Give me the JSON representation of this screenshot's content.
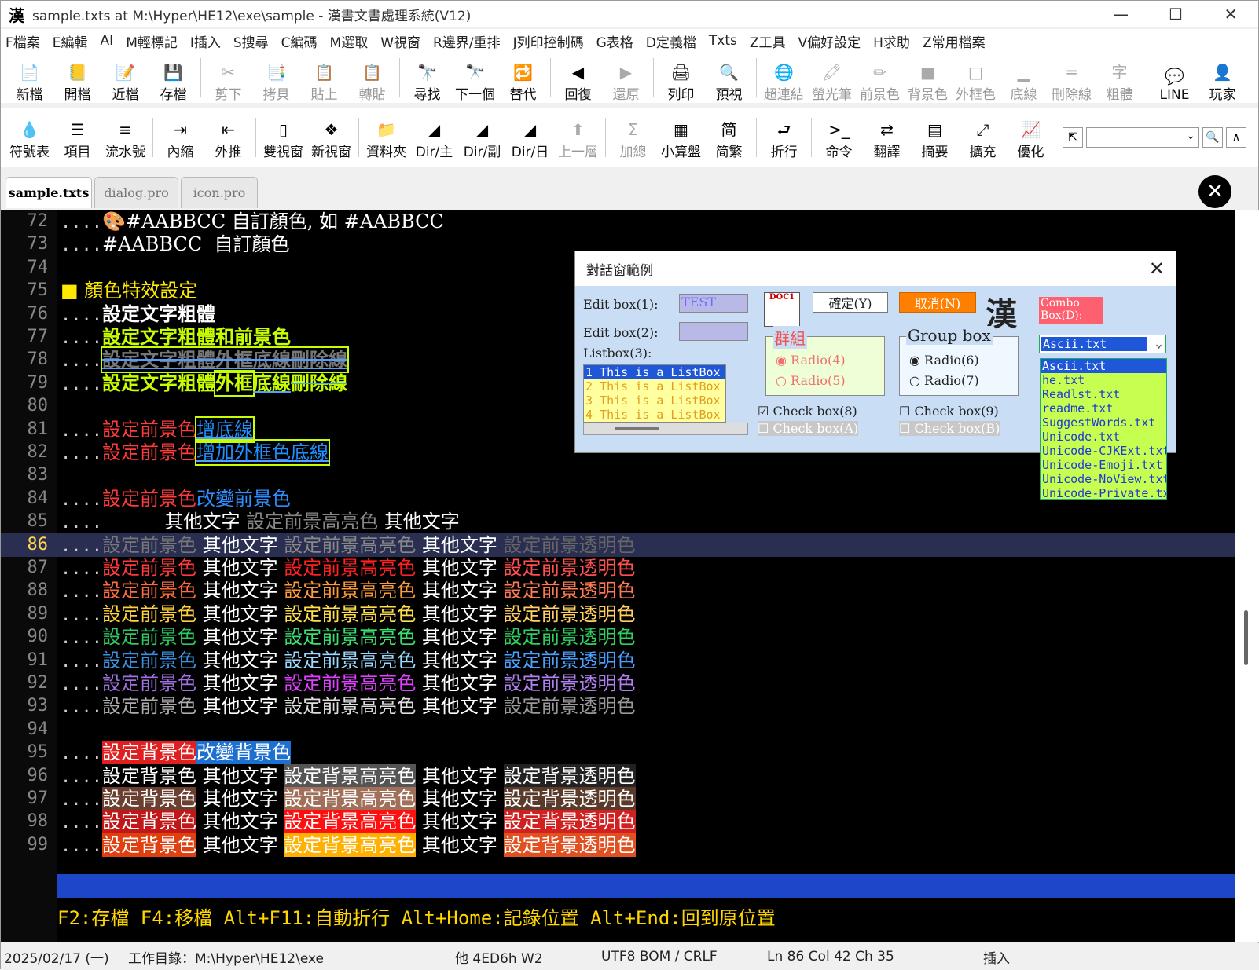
{
  "window": {
    "app_icon": "漢",
    "title": "sample.txts at M:\\Hyper\\HE12\\exe\\sample - 漢書文書處理系統(V12)",
    "min": "—",
    "max": "☐",
    "close": "✕"
  },
  "menu": [
    "F檔案",
    "E編輯",
    "AI",
    "M輕標記",
    "I插入",
    "S搜尋",
    "C編碼",
    "M選取",
    "W視窗",
    "R邊界/重排",
    "J列印控制碼",
    "G表格",
    "D定義檔",
    "Txts",
    "Z工具",
    "V偏好設定",
    "H求助",
    "Z常用檔案"
  ],
  "toolbar1": [
    {
      "icon": "📄",
      "label": "新檔",
      "enabled": true
    },
    {
      "icon": "📒",
      "label": "開檔",
      "enabled": true
    },
    {
      "icon": "📝",
      "label": "近檔",
      "enabled": true
    },
    {
      "icon": "💾",
      "label": "存檔",
      "enabled": true
    },
    {
      "icon": "✂",
      "label": "剪下",
      "enabled": false
    },
    {
      "icon": "📑",
      "label": "拷貝",
      "enabled": false
    },
    {
      "icon": "📋",
      "label": "貼上",
      "enabled": false
    },
    {
      "icon": "📋",
      "label": "轉貼",
      "enabled": false
    },
    {
      "icon": "🔭",
      "label": "尋找",
      "enabled": true
    },
    {
      "icon": "🔭",
      "label": "下一個",
      "enabled": true
    },
    {
      "icon": "🔁",
      "label": "替代",
      "enabled": true
    },
    {
      "icon": "◀",
      "label": "回復",
      "enabled": true
    },
    {
      "icon": "▶",
      "label": "還原",
      "enabled": false
    },
    {
      "icon": "🖨",
      "label": "列印",
      "enabled": true
    },
    {
      "icon": "🔍",
      "label": "預視",
      "enabled": true
    },
    {
      "icon": "🌐",
      "label": "超連結",
      "enabled": false
    },
    {
      "icon": "🖍",
      "label": "螢光筆",
      "enabled": false
    },
    {
      "icon": "✏",
      "label": "前景色",
      "enabled": false
    },
    {
      "icon": "■",
      "label": "背景色",
      "enabled": false
    },
    {
      "icon": "□",
      "label": "外框色",
      "enabled": false
    },
    {
      "icon": "▁",
      "label": "底線",
      "enabled": false
    },
    {
      "icon": "═",
      "label": "刪除線",
      "enabled": false
    },
    {
      "icon": "字",
      "label": "粗體",
      "enabled": false
    },
    {
      "icon": "💬",
      "label": "LINE",
      "enabled": true
    },
    {
      "icon": "👤",
      "label": "玩家",
      "enabled": true
    }
  ],
  "toolbar2": [
    {
      "icon": "💧",
      "label": "符號表"
    },
    {
      "icon": "☰",
      "label": "項目"
    },
    {
      "icon": "≡",
      "label": "流水號"
    },
    {
      "icon": "⇥",
      "label": "內縮"
    },
    {
      "icon": "⇤",
      "label": "外推"
    },
    {
      "icon": "▯",
      "label": "雙視窗"
    },
    {
      "icon": "❖",
      "label": "新視窗"
    },
    {
      "icon": "📁",
      "label": "資料夾"
    },
    {
      "icon": "◢",
      "label": "Dir/主"
    },
    {
      "icon": "◢",
      "label": "Dir/副"
    },
    {
      "icon": "◢",
      "label": "Dir/日"
    },
    {
      "icon": "⬆",
      "label": "上一層"
    },
    {
      "icon": "Σ",
      "label": "加總"
    },
    {
      "icon": "▦",
      "label": "小算盤"
    },
    {
      "icon": "简",
      "label": "简繁"
    },
    {
      "icon": "⮐",
      "label": "折行"
    },
    {
      "icon": ">_",
      "label": "命令"
    },
    {
      "icon": "⇄",
      "label": "翻譯"
    },
    {
      "icon": "▤",
      "label": "摘要"
    },
    {
      "icon": "⤢",
      "label": "擴充"
    },
    {
      "icon": "📈",
      "label": "優化"
    }
  ],
  "search_bar": {
    "back": "⇱",
    "search": "🔍",
    "up": "∧"
  },
  "tabs": [
    "sample.txts",
    "dialog.pro",
    "icon.pro"
  ],
  "close_badge": "✕",
  "lines": [
    {
      "n": "72",
      "segs": [
        {
          "t": "....",
          "c": "#ccc",
          "d": 1
        },
        {
          "t": "🎨#AABBCC 自訂顏色, 如 #AABBCC",
          "c": "#fff"
        }
      ]
    },
    {
      "n": "73",
      "segs": [
        {
          "t": "....",
          "c": "#ccc",
          "d": 1
        },
        {
          "t": "#AABBCC  自訂顏色",
          "c": "#fff"
        }
      ]
    },
    {
      "n": "74",
      "segs": []
    },
    {
      "n": "75",
      "segs": [
        {
          "t": "■ 顏色特效設定",
          "c": "#ffe800"
        }
      ]
    },
    {
      "n": "76",
      "segs": [
        {
          "t": "....",
          "c": "#ccc",
          "d": 1
        },
        {
          "t": "設定文字粗體",
          "c": "#fff",
          "w": "bold"
        }
      ]
    },
    {
      "n": "77",
      "segs": [
        {
          "t": "....",
          "c": "#ccc",
          "d": 1
        },
        {
          "t": "設定文字粗體和前景色",
          "c": "#c8ff00",
          "w": "bold"
        }
      ]
    },
    {
      "n": "78",
      "segs": [
        {
          "t": "....",
          "c": "#ccc",
          "d": 1
        },
        {
          "t": "設定文字粗體外框底線刪除線",
          "c": "#777",
          "w": "bold",
          "b": "#c8ff00",
          "dec": "line-through underline"
        }
      ]
    },
    {
      "n": "79",
      "segs": [
        {
          "t": "....",
          "c": "#ccc",
          "d": 1
        },
        {
          "t": "設定文字粗體",
          "c": "#c8ff00",
          "w": "bold"
        },
        {
          "t": "外框",
          "c": "#c8ff00",
          "w": "bold",
          "b": "#c8ff00"
        },
        {
          "t": "底線",
          "c": "#c8ff00",
          "w": "bold",
          "dec": "underline"
        },
        {
          "t": "刪除線",
          "c": "#c8ff00",
          "w": "bold",
          "dec": "line-through"
        }
      ]
    },
    {
      "n": "80",
      "segs": []
    },
    {
      "n": "81",
      "segs": [
        {
          "t": "....",
          "c": "#ccc",
          "d": 1
        },
        {
          "t": "設定前景色",
          "c": "#ff3a3a"
        },
        {
          "t": "增底線",
          "c": "#1e90ff",
          "b": "#c8ff00",
          "dec": "underline"
        }
      ]
    },
    {
      "n": "82",
      "segs": [
        {
          "t": "....",
          "c": "#ccc",
          "d": 1
        },
        {
          "t": "設定前景色",
          "c": "#ff3a3a"
        },
        {
          "t": "增加外框色底線",
          "c": "#1e90ff",
          "b": "#c8ff00",
          "dec": "underline"
        }
      ]
    },
    {
      "n": "83",
      "segs": []
    },
    {
      "n": "84",
      "segs": [
        {
          "t": "....",
          "c": "#ccc",
          "d": 1
        },
        {
          "t": "設定前景色",
          "c": "#ff3a3a"
        },
        {
          "t": "改變前景色",
          "c": "#2e8dff"
        }
      ]
    },
    {
      "n": "85",
      "segs": [
        {
          "t": "....      ",
          "c": "#ccc",
          "d": 1
        },
        {
          "t": "其他文字 ",
          "c": "#fff"
        },
        {
          "t": "設定前景高亮色 ",
          "c": "#888"
        },
        {
          "t": "其他文字",
          "c": "#fff"
        }
      ]
    },
    {
      "n": "86",
      "cur": 1,
      "segs": [
        {
          "t": "....",
          "c": "#ccc",
          "d": 1
        },
        {
          "t": "設定前景色 ",
          "c": "#777"
        },
        {
          "t": "其他文字 ",
          "c": "#fff"
        },
        {
          "t": "設定前景高亮色 ",
          "c": "#888"
        },
        {
          "t": "其他文字 ",
          "c": "#fff"
        },
        {
          "t": "設定前景透明色",
          "c": "#666"
        }
      ]
    },
    {
      "n": "87",
      "segs": [
        {
          "t": "....",
          "c": "#ccc",
          "d": 1
        },
        {
          "t": "設定前景色 ",
          "c": "#ff3a3a"
        },
        {
          "t": "其他文字 ",
          "c": "#fff"
        },
        {
          "t": "設定前景高亮色 ",
          "c": "#ff2020"
        },
        {
          "t": "其他文字 ",
          "c": "#fff"
        },
        {
          "t": "設定前景透明色",
          "c": "#ff5050"
        }
      ]
    },
    {
      "n": "88",
      "segs": [
        {
          "t": "....",
          "c": "#ccc",
          "d": 1
        },
        {
          "t": "設定前景色 ",
          "c": "#ff6a3a"
        },
        {
          "t": "其他文字 ",
          "c": "#fff"
        },
        {
          "t": "設定前景高亮色 ",
          "c": "#ff9a3a"
        },
        {
          "t": "其他文字 ",
          "c": "#fff"
        },
        {
          "t": "設定前景透明色",
          "c": "#ff7a50"
        }
      ]
    },
    {
      "n": "89",
      "segs": [
        {
          "t": "....",
          "c": "#ccc",
          "d": 1
        },
        {
          "t": "設定前景色 ",
          "c": "#ffd23a"
        },
        {
          "t": "其他文字 ",
          "c": "#fff"
        },
        {
          "t": "設定前景高亮色 ",
          "c": "#ffe04a"
        },
        {
          "t": "其他文字 ",
          "c": "#fff"
        },
        {
          "t": "設定前景透明色",
          "c": "#ffd060"
        }
      ]
    },
    {
      "n": "90",
      "segs": [
        {
          "t": "....",
          "c": "#ccc",
          "d": 1
        },
        {
          "t": "設定前景色 ",
          "c": "#2ec860"
        },
        {
          "t": "其他文字 ",
          "c": "#fff"
        },
        {
          "t": "設定前景高亮色 ",
          "c": "#3ae070"
        },
        {
          "t": "其他文字 ",
          "c": "#fff"
        },
        {
          "t": "設定前景透明色",
          "c": "#30d060"
        }
      ]
    },
    {
      "n": "91",
      "segs": [
        {
          "t": "....",
          "c": "#ccc",
          "d": 1
        },
        {
          "t": "設定前景色 ",
          "c": "#3a90e0"
        },
        {
          "t": "其他文字 ",
          "c": "#fff"
        },
        {
          "t": "設定前景高亮色 ",
          "c": "#9ad8ff"
        },
        {
          "t": "其他文字 ",
          "c": "#fff"
        },
        {
          "t": "設定前景透明色",
          "c": "#4aa0ff"
        }
      ]
    },
    {
      "n": "92",
      "segs": [
        {
          "t": "....",
          "c": "#ccc",
          "d": 1
        },
        {
          "t": "設定前景色 ",
          "c": "#a070e0"
        },
        {
          "t": "其他文字 ",
          "c": "#fff"
        },
        {
          "t": "設定前景高亮色 ",
          "c": "#e040ff"
        },
        {
          "t": "其他文字 ",
          "c": "#fff"
        },
        {
          "t": "設定前景透明色",
          "c": "#b080f0"
        }
      ]
    },
    {
      "n": "93",
      "segs": [
        {
          "t": "....",
          "c": "#ccc",
          "d": 1
        },
        {
          "t": "設定前景色 ",
          "c": "#aaa"
        },
        {
          "t": "其他文字 ",
          "c": "#fff"
        },
        {
          "t": "設定前景高亮色 ",
          "c": "#ddd"
        },
        {
          "t": "其他文字 ",
          "c": "#fff"
        },
        {
          "t": "設定前景透明色",
          "c": "#999"
        }
      ]
    },
    {
      "n": "94",
      "segs": []
    },
    {
      "n": "95",
      "segs": [
        {
          "t": "....",
          "c": "#ccc",
          "d": 1
        },
        {
          "t": "設定背景色",
          "c": "#fff",
          "bg": "#e02020"
        },
        {
          "t": "改變背景色",
          "c": "#fff",
          "bg": "#1e70d0"
        }
      ]
    },
    {
      "n": "96",
      "segs": [
        {
          "t": "....",
          "c": "#ccc",
          "d": 1
        },
        {
          "t": "設定背景色 ",
          "c": "#fff"
        },
        {
          "t": "其他文字 ",
          "c": "#fff"
        },
        {
          "t": "設定背景高亮色",
          "c": "#fff",
          "bg": "#555"
        },
        {
          "t": " 其他文字 ",
          "c": "#fff"
        },
        {
          "t": "設定背景透明色",
          "c": "#fff",
          "bg": "#222"
        }
      ]
    },
    {
      "n": "97",
      "segs": [
        {
          "t": "....",
          "c": "#ccc",
          "d": 1
        },
        {
          "t": "設定背景色",
          "c": "#fff",
          "bg": "#6b4030"
        },
        {
          "t": " 其他文字 ",
          "c": "#fff"
        },
        {
          "t": "設定背景高亮色",
          "c": "#fff",
          "bg": "#a0705a"
        },
        {
          "t": " 其他文字 ",
          "c": "#fff"
        },
        {
          "t": "設定背景透明色",
          "c": "#fff",
          "bg": "#5a3a2a"
        }
      ]
    },
    {
      "n": "98",
      "segs": [
        {
          "t": "....",
          "c": "#ccc",
          "d": 1
        },
        {
          "t": "設定背景色",
          "c": "#fff",
          "bg": "#c01818"
        },
        {
          "t": " 其他文字 ",
          "c": "#fff"
        },
        {
          "t": "設定背景高亮色",
          "c": "#fff",
          "bg": "#ff1010"
        },
        {
          "t": " 其他文字 ",
          "c": "#fff"
        },
        {
          "t": "設定背景透明色",
          "c": "#fff",
          "bg": "#d02020"
        }
      ]
    },
    {
      "n": "99",
      "segs": [
        {
          "t": "....",
          "c": "#ccc",
          "d": 1
        },
        {
          "t": "設定背景色",
          "c": "#fff",
          "bg": "#e04010"
        },
        {
          "t": " 其他文字 ",
          "c": "#fff"
        },
        {
          "t": "設定背景高亮色",
          "c": "#fff",
          "bg": "#ffb000"
        },
        {
          "t": " 其他文字 ",
          "c": "#fff"
        },
        {
          "t": "設定背景透明色",
          "c": "#fff",
          "bg": "#e05020"
        }
      ]
    }
  ],
  "hint_line": "F2:存檔 F4:移檔 Alt+F11:自動折行 Alt+Home:記錄位置 Alt+End:回到原位置",
  "status": {
    "date": "2025/02/17 (一)",
    "cwd": "工作目錄：M:\\Hyper\\HE12\\exe",
    "char": "他 4ED6h W2",
    "encoding": "UTF8 BOM / CRLF",
    "pos": "Ln 86  Col 42  Ch 35",
    "mode": "插入"
  },
  "dialog": {
    "title": "對話窗範例",
    "close": "✕",
    "edit1_label": "Edit box(1):",
    "edit1_value": "TEST",
    "edit2_label": "Edit box(2):",
    "edit2_value": "",
    "listbox_label": "Listbox(3):",
    "listbox_items": [
      "1 This is a ListBox",
      "2 This is a ListBox",
      "3 This is a ListBox",
      "4 This is a ListBox"
    ],
    "doc_icon": "DOC1",
    "ok": "確定(Y)",
    "cancel": "取消(N)",
    "han": "漢",
    "group1_title": "群組",
    "radio4": "Radio(4)",
    "radio5": "Radio(5)",
    "group2_title": "Group box",
    "radio6": "Radio(6)",
    "radio7": "Radio(7)",
    "check8": "Check box(8)",
    "checkA": "Check box(A)",
    "check9": "Check box(9)",
    "checkB": "Check box(B)",
    "combo_label1": "Combo",
    "combo_label2": "Box(D):",
    "combo_value": "Ascii.txt",
    "combo_items": [
      "Ascii.txt",
      "he.txt",
      "Readlst.txt",
      "readme.txt",
      "SuggestWords.txt",
      "Unicode.txt",
      "Unicode-CJKExt.txt",
      "Unicode-Emoji.txt",
      "Unicode-NoView.txt",
      "Unicode-Private.txt"
    ]
  }
}
